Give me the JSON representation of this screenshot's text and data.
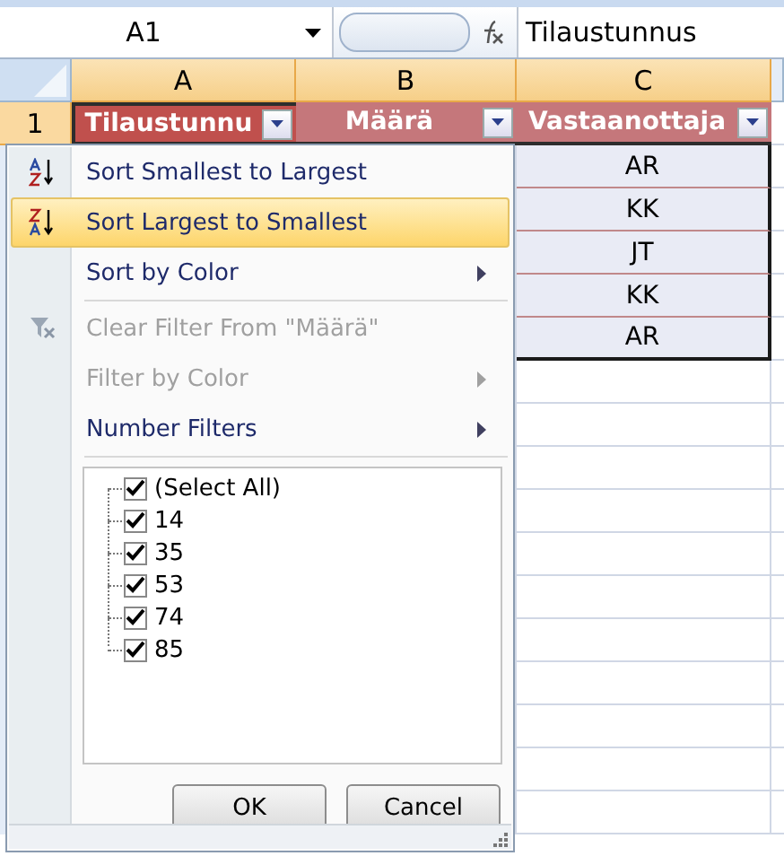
{
  "name_box": "A1",
  "formula": "Tilaustunnus",
  "columns": [
    {
      "label": "A",
      "selected": true
    },
    {
      "label": "B",
      "selected": true
    },
    {
      "label": "C",
      "selected": true
    }
  ],
  "header_row": {
    "number": "1",
    "cells": [
      {
        "text": "Tilaustunnu",
        "selected": true
      },
      {
        "text": "Määrä",
        "selected": false
      },
      {
        "text": "Vastaanottaja",
        "selected": false
      }
    ]
  },
  "column_c_values": [
    "AR",
    "KK",
    "JT",
    "KK",
    "AR"
  ],
  "filter_menu": {
    "items": [
      {
        "kind": "ascending",
        "label": "Sort Smallest to Largest",
        "selected": false,
        "disabled": false,
        "submenu": false
      },
      {
        "kind": "descending",
        "label": "Sort Largest to Smallest",
        "selected": true,
        "disabled": false,
        "submenu": false
      },
      {
        "kind": "item",
        "label": "Sort by Color",
        "selected": false,
        "disabled": false,
        "submenu": true
      },
      {
        "kind": "separator"
      },
      {
        "kind": "clearing",
        "label": "Clear Filter From \"Määrä\"",
        "selected": false,
        "disabled": true,
        "submenu": false
      },
      {
        "kind": "item",
        "label": "Filter by Color",
        "selected": false,
        "disabled": true,
        "submenu": true
      },
      {
        "kind": "item",
        "label": "Number Filters",
        "selected": false,
        "disabled": false,
        "submenu": true
      },
      {
        "kind": "separator"
      }
    ],
    "values": [
      {
        "label": "(Select All)",
        "checked": true
      },
      {
        "label": "14",
        "checked": true
      },
      {
        "label": "35",
        "checked": true
      },
      {
        "label": "53",
        "checked": true
      },
      {
        "label": "74",
        "checked": true
      },
      {
        "label": "85",
        "checked": true
      }
    ],
    "buttons": [
      "OK",
      "Cancel"
    ]
  }
}
